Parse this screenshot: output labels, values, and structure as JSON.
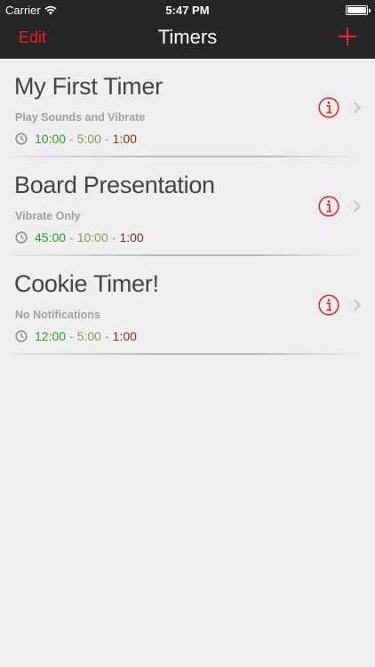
{
  "status_bar": {
    "carrier": "Carrier",
    "time": "5:47 PM",
    "battery_level": 1.0
  },
  "nav": {
    "edit_label": "Edit",
    "title": "Timers",
    "add_icon": "plus-icon"
  },
  "colors": {
    "accent": "#e8262b",
    "time_primary": "#2e9b2e",
    "time_warning": "#8e935c",
    "time_final": "#8b2a2a"
  },
  "timers": [
    {
      "name": "My First Timer",
      "mode": "Play Sounds and Vibrate",
      "t1": "10:00",
      "t2": "5:00",
      "t3": "1:00"
    },
    {
      "name": "Board Presentation",
      "mode": "Vibrate Only",
      "t1": "45:00",
      "t2": "10:00",
      "t3": "1:00"
    },
    {
      "name": "Cookie Timer!",
      "mode": "No Notifications",
      "t1": "12:00",
      "t2": "5:00",
      "t3": "1:00"
    }
  ]
}
